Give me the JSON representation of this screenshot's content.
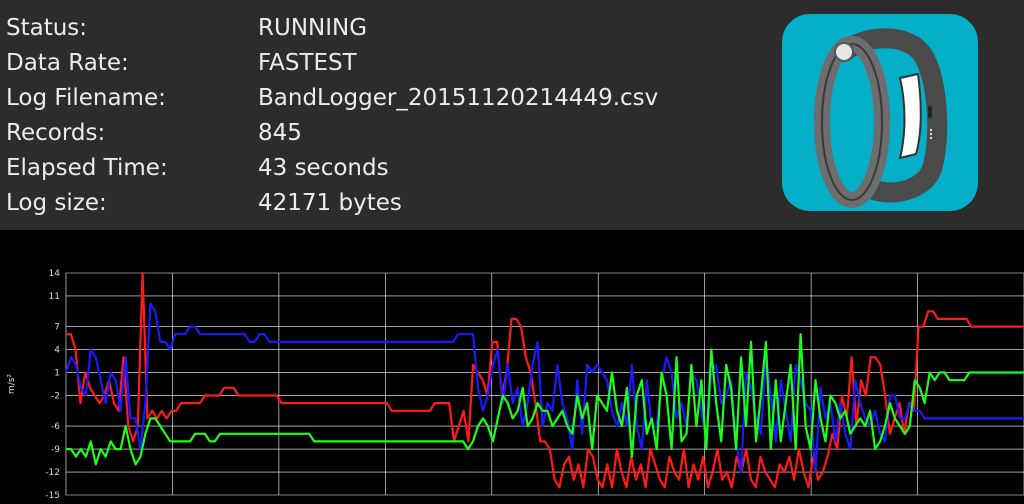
{
  "status": {
    "rows": [
      {
        "label": "Status:",
        "value": "RUNNING"
      },
      {
        "label": "Data Rate:",
        "value": "FASTEST"
      },
      {
        "label": "Log Filename:",
        "value": "BandLogger_20151120214449.csv"
      },
      {
        "label": "Records:",
        "value": "845"
      },
      {
        "label": "Elapsed Time:",
        "value": "43 seconds"
      },
      {
        "label": "Log size:",
        "value": "42171 bytes"
      }
    ]
  },
  "app_icon": {
    "name": "band-icon",
    "background": "#05afc8"
  },
  "chart_data": {
    "type": "line",
    "ylabel": "m/s²",
    "yticks": [
      14,
      11,
      7,
      4,
      1,
      -2,
      -6,
      -9,
      -12,
      -15
    ],
    "ylim": [
      -15,
      14
    ],
    "grid": true,
    "series": [
      {
        "color": "#ff1a1a",
        "values": [
          6,
          6,
          4,
          -3,
          1,
          -1,
          -2,
          -3,
          -2,
          0,
          -3,
          -4,
          3,
          -6,
          -8,
          -6,
          14,
          -5,
          -4,
          -5,
          -4,
          -5,
          -4,
          -4,
          -3,
          -3,
          -3,
          -3,
          -3,
          -2,
          -2,
          -2,
          -2,
          -1,
          -1,
          -1,
          -2,
          -2,
          -2,
          -2,
          -2,
          -2,
          -2,
          -2,
          -2,
          -3,
          -3,
          -3,
          -3,
          -3,
          -3,
          -3,
          -3,
          -3,
          -3,
          -3,
          -3,
          -3,
          -3,
          -3,
          -3,
          -3,
          -3,
          -3,
          -3,
          -3,
          -3,
          -3,
          -4,
          -4,
          -4,
          -4,
          -4,
          -4,
          -4,
          -4,
          -4,
          -3,
          -3,
          -3,
          -3,
          -8,
          -6,
          -4,
          -8,
          2,
          1,
          0,
          -2,
          5,
          5,
          -2,
          1,
          8,
          8,
          7,
          3,
          1,
          -3,
          -8,
          -8,
          -9,
          -13,
          -14,
          -11,
          -10,
          -13,
          -11,
          -14,
          -9,
          -10,
          -13,
          -14,
          -11,
          -14,
          -9,
          -12,
          -14,
          -10,
          -13,
          -11,
          -14,
          -9,
          -11,
          -13,
          -14,
          -10,
          -12,
          -13,
          -9,
          -14,
          -11,
          -13,
          -10,
          -14,
          -12,
          -9,
          -13,
          -12,
          -14,
          -10,
          -12,
          -9,
          -13,
          -14,
          -10,
          -12,
          -13,
          -14,
          -11,
          -12,
          -10,
          -13,
          -9,
          -12,
          -14,
          -10,
          -13,
          -12,
          -10,
          -7,
          -9,
          -2,
          -5,
          3,
          -6,
          0,
          -2,
          3,
          3,
          2,
          -2,
          -7,
          -5,
          -3,
          -7,
          -3,
          -4,
          7,
          7,
          9,
          9,
          8,
          8,
          8,
          8,
          8,
          8,
          8,
          7,
          7,
          7,
          7,
          7,
          7,
          7,
          7,
          7,
          7,
          7,
          7
        ]
      },
      {
        "color": "#1a1aff",
        "values": [
          1,
          3,
          2,
          -1,
          -2,
          4,
          3,
          0,
          -3,
          1,
          0,
          -4,
          3,
          -5,
          -5,
          -9,
          -3,
          10,
          9,
          5,
          5,
          4,
          6,
          6,
          6,
          7,
          7,
          6,
          6,
          6,
          6,
          6,
          6,
          6,
          6,
          6,
          6,
          5,
          5,
          6,
          6,
          5,
          5,
          5,
          5,
          5,
          5,
          5,
          5,
          5,
          5,
          5,
          5,
          5,
          5,
          5,
          5,
          5,
          5,
          5,
          5,
          5,
          5,
          5,
          5,
          5,
          5,
          5,
          5,
          5,
          5,
          5,
          5,
          5,
          5,
          5,
          5,
          5,
          5,
          6,
          6,
          6,
          6,
          -1,
          -4,
          -2,
          2,
          4,
          -3,
          2,
          -3,
          -1,
          -6,
          -3,
          2,
          5,
          -6,
          -3,
          -4,
          2,
          -3,
          -5,
          -9,
          0,
          -7,
          2,
          1,
          2,
          1,
          0,
          -4,
          -6,
          -3,
          -6,
          2,
          -6,
          -9,
          0,
          -6,
          -6,
          0,
          3,
          1,
          -5,
          -3,
          -6,
          1,
          0,
          -4,
          -8,
          1,
          2,
          -3,
          -2,
          0,
          -8,
          -12,
          1,
          -1,
          -5,
          -7,
          3,
          -2,
          -8,
          0,
          -4,
          -8,
          2,
          0,
          -3,
          -4,
          -12,
          -1,
          -5,
          -3,
          -8,
          -3,
          -7,
          -9,
          0,
          -3,
          -5,
          -6,
          -4,
          -7,
          -8,
          -2,
          -2,
          -5,
          -5,
          -3,
          -4,
          -4,
          -5,
          -5,
          -5,
          -5,
          -5,
          -5,
          -5,
          -5,
          -5,
          -5,
          -5,
          -5,
          -5,
          -5,
          -5,
          -5,
          -5,
          -5,
          -5,
          -5,
          -5
        ]
      },
      {
        "color": "#1aff1a",
        "values": [
          -9,
          -9,
          -10,
          -9,
          -10,
          -8,
          -11,
          -9,
          -10,
          -8,
          -9,
          -9,
          -6,
          -9,
          -11,
          -10,
          -7,
          -5,
          -5,
          -6,
          -7,
          -8,
          -8,
          -8,
          -8,
          -8,
          -7,
          -7,
          -7,
          -8,
          -8,
          -7,
          -7,
          -7,
          -7,
          -7,
          -7,
          -7,
          -7,
          -7,
          -7,
          -7,
          -7,
          -7,
          -7,
          -7,
          -7,
          -7,
          -7,
          -7,
          -8,
          -8,
          -8,
          -8,
          -8,
          -8,
          -8,
          -8,
          -8,
          -8,
          -8,
          -8,
          -8,
          -8,
          -8,
          -8,
          -8,
          -8,
          -8,
          -8,
          -8,
          -8,
          -8,
          -8,
          -8,
          -8,
          -8,
          -8,
          -8,
          -8,
          -8,
          -9,
          -8,
          -6,
          -5,
          -6,
          -8,
          -5,
          -2,
          -3,
          -5,
          -4,
          -1,
          -6,
          -5,
          -3,
          -4,
          -4,
          -6,
          -5,
          -4,
          -6,
          -7,
          -2,
          -5,
          -3,
          -9,
          -2,
          -3,
          -4,
          1,
          -4,
          -6,
          -1,
          -10,
          -2,
          0,
          -7,
          -5,
          -9,
          1,
          -2,
          -9,
          3,
          -8,
          -7,
          2,
          -6,
          0,
          -9,
          4,
          -3,
          -8,
          2,
          -1,
          -9,
          3,
          -6,
          5,
          -8,
          -2,
          5,
          -9,
          0,
          -8,
          -3,
          2,
          -9,
          6,
          -6,
          -9,
          0,
          -5,
          -8,
          -2,
          -3,
          -5,
          -4,
          -7,
          -6,
          -5,
          -6,
          -4,
          -9,
          -8,
          -6,
          -3,
          -5,
          -6,
          -7,
          -6,
          0,
          -1,
          -3,
          1,
          0,
          1,
          1,
          0,
          0,
          0,
          0,
          1,
          1,
          1,
          1,
          1,
          1,
          1,
          1,
          1,
          1,
          1,
          1
        ]
      }
    ]
  }
}
